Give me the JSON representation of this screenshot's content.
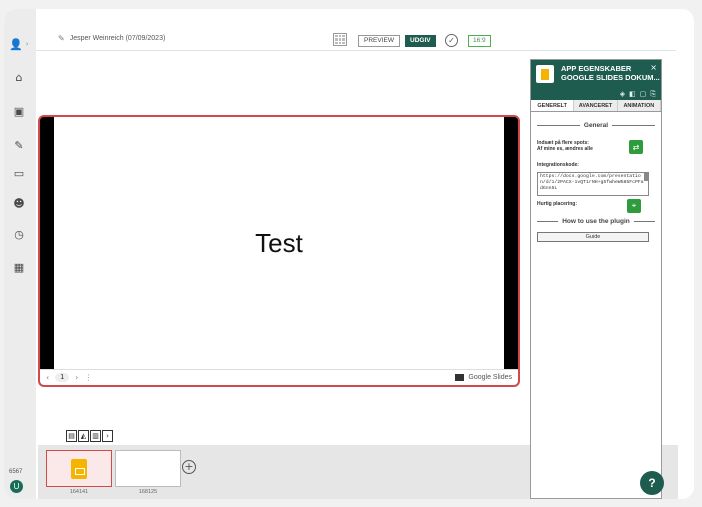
{
  "toolbar": {
    "author": "Jesper Weinreich (07/09/2023)",
    "preview_label": "PREVIEW",
    "publish_label": "UDGIV",
    "ratio_label": "16:9"
  },
  "slide": {
    "text": "Test",
    "page": "1",
    "provider": "Google Slides"
  },
  "thumbnails": [
    {
      "label": "164141"
    },
    {
      "label": "168125"
    }
  ],
  "rail": {
    "counter": "6567",
    "avatar": "U"
  },
  "panel": {
    "title_line1": "APP EGENSKABER",
    "title_line2": "GOOGLE SLIDES DOKUM...",
    "tabs": [
      "GENERELT",
      "AVANCERET",
      "ANIMATION"
    ],
    "section_general": "General",
    "field_multi_line1": "Indsæt på flere spots:",
    "field_multi_line2": "Af mine es, ændres alle",
    "field_embed_label": "Integrationskode:",
    "embed_code": "https://docs.google.com/presentation/d/1/2PACX-1vQT1rNH+g5fwheW585FcPFadGnn5L",
    "field_placement_label": "Hurtig placering:",
    "section_plugin": "How to use the plugin",
    "guide_label": "Guide"
  },
  "help_label": "?",
  "accent_color": "#1e5c4f"
}
